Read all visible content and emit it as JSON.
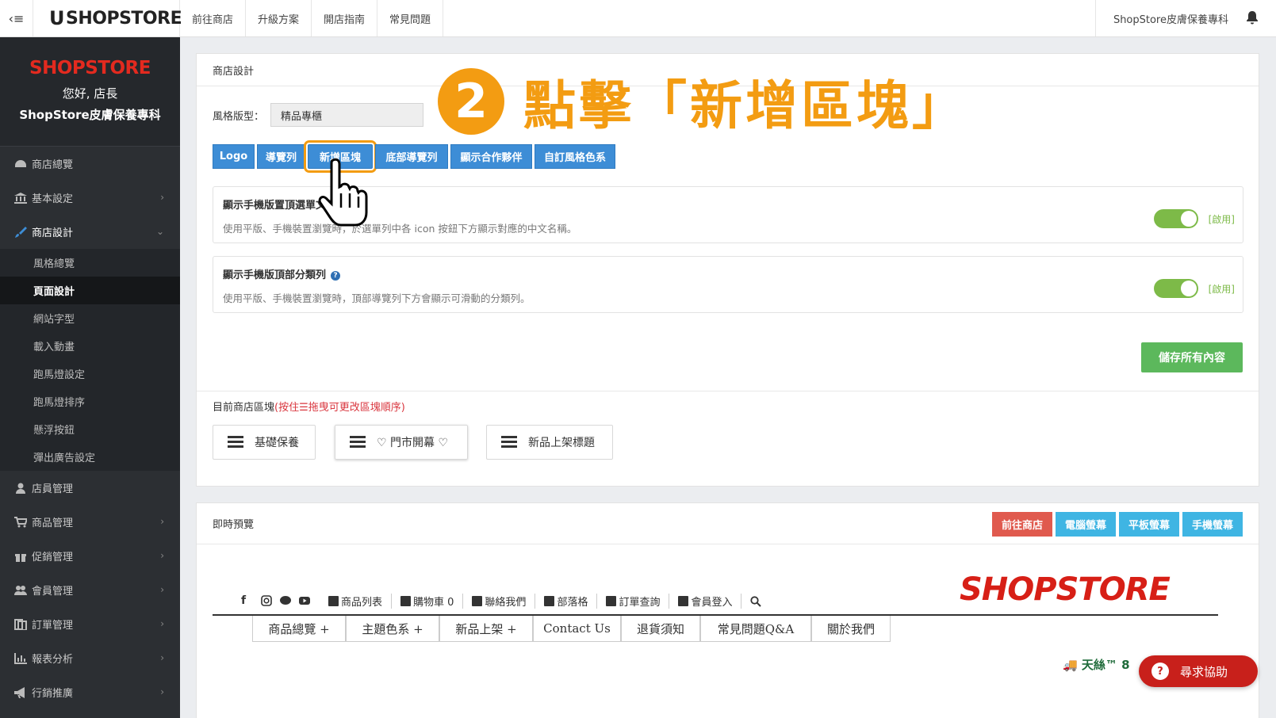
{
  "topbar": {
    "menu_toggle": "‹≡",
    "logo_text": "SHOPSTORE",
    "nav": [
      "前往商店",
      "升級方案",
      "開店指南",
      "常見問題"
    ],
    "store_name": "ShopStore皮膚保養專科"
  },
  "sidebar": {
    "logo_text": "SHOPSTORE",
    "greeting": "您好, 店長",
    "store_name": "ShopStore皮膚保養專科",
    "items": [
      {
        "label": "商店總覽",
        "icon": "dashboard-icon"
      },
      {
        "label": "基本設定",
        "icon": "bank-icon"
      },
      {
        "label": "商店設計",
        "icon": "brush-icon"
      }
    ],
    "sub_items": [
      "風格總覽",
      "頁面設計",
      "網站字型",
      "載入動畫",
      "跑馬燈設定",
      "跑馬燈排序",
      "懸浮按鈕",
      "彈出廣告設定"
    ],
    "items_after": [
      {
        "label": "店員管理",
        "icon": "staff-icon"
      },
      {
        "label": "商品管理",
        "icon": "cart-icon"
      },
      {
        "label": "促銷管理",
        "icon": "gift-icon"
      },
      {
        "label": "會員管理",
        "icon": "users-icon"
      },
      {
        "label": "訂單管理",
        "icon": "orders-icon"
      },
      {
        "label": "報表分析",
        "icon": "chart-icon"
      },
      {
        "label": "行銷推廣",
        "icon": "bullhorn-icon"
      }
    ]
  },
  "design_panel": {
    "title": "商店設計",
    "style_label": "風格版型：",
    "style_value": "精品專櫃",
    "tab_buttons": [
      "Logo",
      "導覽列",
      "新增區塊",
      "底部導覽列",
      "顯示合作夥伴",
      "自訂風格色系"
    ],
    "options": [
      {
        "title": "顯示手機版置頂選單文字",
        "desc": "使用平版、手機裝置瀏覽時，於選單列中各 icon 按鈕下方顯示對應的中文名稱。",
        "state": "[啟用]"
      },
      {
        "title": "顯示手機版頂部分類列",
        "desc": "使用平版、手機裝置瀏覽時，頂部導覽列下方會顯示可滑動的分類列。",
        "state": "[啟用]"
      }
    ],
    "save_label": "儲存所有內容",
    "blocks_title": "目前商店區塊",
    "blocks_hint": "(按住☰拖曳可更改區塊順序)",
    "blocks": [
      "基礎保養",
      "♡ 門市開幕 ♡",
      "新品上架標題"
    ]
  },
  "annotation": {
    "number": "2",
    "text": "點擊「新增區塊」"
  },
  "preview": {
    "title": "即時預覽",
    "buttons": [
      {
        "label": "前往商店",
        "color": "#d9534f"
      },
      {
        "label": "電腦螢幕",
        "color": "#3fb5e3"
      },
      {
        "label": "平板螢幕",
        "color": "#3fb5e3"
      },
      {
        "label": "手機螢幕",
        "color": "#3fb5e3"
      }
    ],
    "logo_text": "SHOPSTORE",
    "links": [
      "商品列表",
      "購物車 0",
      "聯絡我們",
      "部落格",
      "訂單查詢",
      "會員登入"
    ],
    "menu": [
      "商品總覽 +",
      "主題色系 +",
      "新品上架 +",
      "Contact Us",
      "退貨須知",
      "常見問題Q&A",
      "關於我們"
    ],
    "ticker": "天絲™ 8"
  },
  "help_button": "尋求協助",
  "colors": {
    "sidebar_bg": "#2c2f33",
    "primary_blue": "#3d8dd6",
    "highlight_orange": "#f39c12",
    "toggle_green": "#7dba48",
    "save_green": "#5cb85c",
    "help_red": "#c8201b"
  }
}
